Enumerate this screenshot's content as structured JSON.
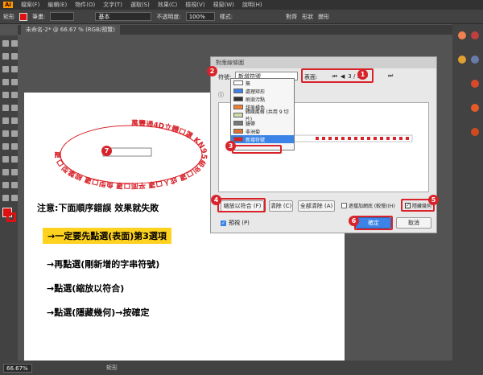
{
  "menubar": {
    "logo": "Ai",
    "items": [
      "檔案(F)",
      "編輯(E)",
      "物件(O)",
      "文字(T)",
      "選取(S)",
      "效果(C)",
      "檢視(V)",
      "視窗(W)",
      "說明(H)"
    ]
  },
  "controlbar": {
    "object_label": "矩形",
    "stroke_label": "筆畫:",
    "stroke_style": "基本",
    "opacity_label": "不透明度:",
    "opacity_value": "100%",
    "style_label": "樣式:",
    "align_label": "對齊",
    "shape_label": "形狀",
    "transform_label": "變形"
  },
  "document_tab": "未命名-2* @ 66.67 % (RGB/預覽)",
  "statusbar": {
    "zoom": "66.67%",
    "tool": "矩形"
  },
  "artwork": {
    "ellipse_text": "萬豐通4D立體口罩 KN95級別口罩 成人口罩 平面口罩 魚型口罩 柳葉型口罩"
  },
  "notes": {
    "heading": "注意:下面順序錯誤 效果就失敗",
    "step1": "→一定要先點選(表面)第3選項",
    "step2": "→再點選(剛新增的字串符號)",
    "step3": "→點選(縮放以符合)",
    "step4": "→點選(隱藏幾何)→按確定"
  },
  "dialog": {
    "title": "對應線條圖",
    "symbol_label": "符號:",
    "symbol_value": "新增符號",
    "surface_label": "表面:",
    "surface_value": "3 / 3",
    "scale_to_fit": "縮放以符合 (F)",
    "clear": "清除 (C)",
    "clear_all": "全部清除 (A)",
    "shade_label": "遮擋加網底 (較慢)(H)",
    "hide_geometry": "隱藏幾何",
    "preview_label": "預視 (P)",
    "ok": "確定",
    "cancel": "取消",
    "symbol_options": [
      "無",
      "處理矩形",
      "刷漸污點",
      "甜美橘色",
      "韓國風格 (共用 9 切片)",
      "鏡帶",
      "非洲菊",
      "新增符號"
    ]
  },
  "badges": [
    "1",
    "2",
    "3",
    "4",
    "5",
    "6",
    "7"
  ],
  "colors": {
    "accent_red": "#d8232a",
    "fill_red": "#e01010",
    "highlight_yellow": "#ffd21f"
  }
}
